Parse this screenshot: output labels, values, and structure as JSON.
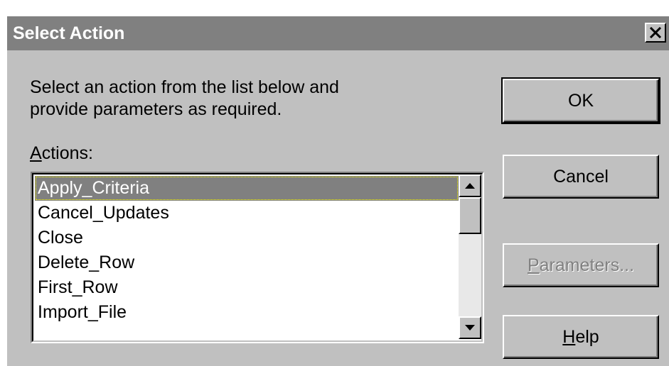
{
  "window": {
    "title": "Select Action",
    "close_icon": "close-icon"
  },
  "instructions": "Select an action from the list below and\nprovide parameters as required.",
  "actions_label": {
    "mnemonic": "A",
    "rest": "ctions:"
  },
  "actions_list": {
    "selected_index": 0,
    "items": [
      "Apply_Criteria",
      "Cancel_Updates",
      "Close",
      "Delete_Row",
      "First_Row",
      "Import_File"
    ]
  },
  "buttons": {
    "ok": {
      "label": "OK"
    },
    "cancel": {
      "label": "Cancel"
    },
    "parameters": {
      "mnemonic": "P",
      "rest": "arameters...",
      "enabled": false
    },
    "help": {
      "mnemonic": "H",
      "rest": "elp"
    }
  },
  "colors": {
    "title_bar": "#808080",
    "dialog_face": "#c0c0c0",
    "selection": "#808080",
    "disabled_text": "#808080"
  }
}
